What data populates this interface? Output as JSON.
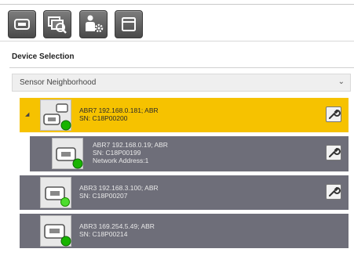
{
  "toolbar": {
    "buttons": [
      {
        "icon": "device-icon"
      },
      {
        "icon": "search-refresh-icon"
      },
      {
        "icon": "user-settings-icon"
      },
      {
        "icon": "window-icon"
      }
    ]
  },
  "section": {
    "title": "Device Selection"
  },
  "dropdown": {
    "selected": "Sensor Neighborhood",
    "chevron": "⌄"
  },
  "devices": [
    {
      "line1": "ABR7 192.168.0.181; ABR",
      "line2": "SN: C18P00200",
      "line3": "",
      "selected": true,
      "expanded": true,
      "status": "connected"
    },
    {
      "line1": "ABR7 192.168.0.19; ABR",
      "line2": "SN: C18P00199",
      "line3": "Network Address:1",
      "selected": false,
      "status": "connected"
    },
    {
      "line1": "ABR3 192.168.3.100; ABR",
      "line2": "SN: C18P00207",
      "line3": "",
      "selected": false,
      "status": "available"
    },
    {
      "line1": "ABR3 169.254.5.49; ABR",
      "line2": "SN: C18P00214",
      "line3": "",
      "selected": false,
      "status": "connected"
    }
  ],
  "colors": {
    "selected_bg": "#f6c200",
    "row_bg": "#6e6e79",
    "status_green": "#18b400",
    "status_light_green": "#4ddd2e"
  }
}
